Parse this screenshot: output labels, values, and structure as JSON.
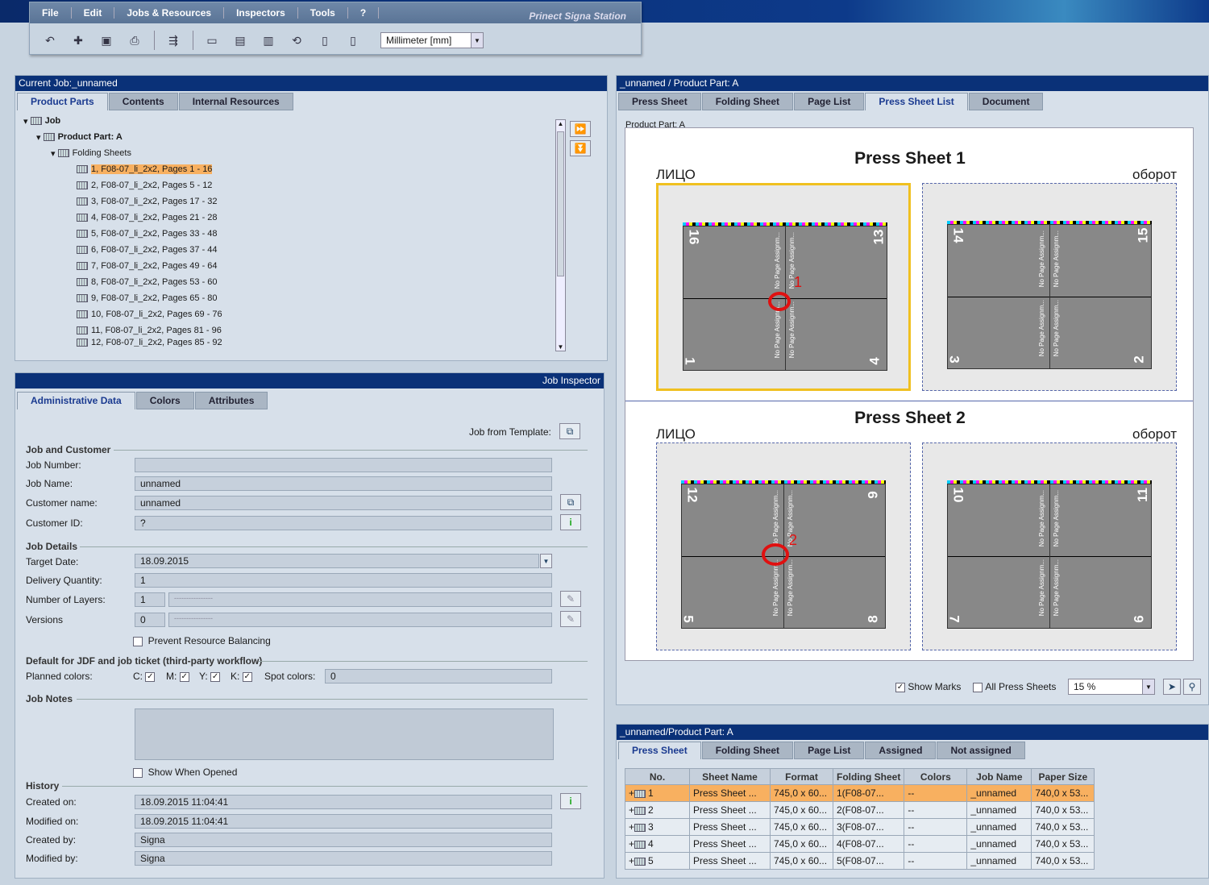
{
  "app": {
    "title": "Prinect Signa Station"
  },
  "menu": [
    "File",
    "Edit",
    "Jobs & Resources",
    "Inspectors",
    "Tools",
    "?"
  ],
  "toolbar": {
    "units": "Millimeter  [mm]"
  },
  "job_panel": {
    "title": "Current Job:_unnamed",
    "tabs": [
      "Product Parts",
      "Contents",
      "Internal Resources"
    ],
    "tree": {
      "job": "Job",
      "product_part": "Product Part: A",
      "folding_sheets": "Folding Sheets",
      "items": [
        "1, F08-07_li_2x2, Pages 1 - 16",
        "2, F08-07_li_2x2, Pages 5 - 12",
        "3, F08-07_li_2x2, Pages 17 - 32",
        "4, F08-07_li_2x2, Pages 21 - 28",
        "5, F08-07_li_2x2, Pages 33 - 48",
        "6, F08-07_li_2x2, Pages 37 - 44",
        "7, F08-07_li_2x2, Pages 49 - 64",
        "8, F08-07_li_2x2, Pages 53 - 60",
        "9, F08-07_li_2x2, Pages 65 - 80",
        "10, F08-07_li_2x2, Pages 69 - 76",
        "11, F08-07_li_2x2, Pages 81 - 96",
        "12, F08-07_li_2x2, Pages 85 - 92"
      ]
    }
  },
  "inspector": {
    "title": "Job Inspector",
    "tabs": [
      "Administrative Data",
      "Colors",
      "Attributes"
    ],
    "job_from_template": "Job from Template:",
    "sec_job_customer": "Job and Customer",
    "job_number_label": "Job Number:",
    "job_number": "",
    "job_name_label": "Job Name:",
    "job_name": "unnamed",
    "customer_name_label": "Customer name:",
    "customer_name": "unnamed",
    "customer_id_label": "Customer ID:",
    "customer_id": "?",
    "sec_job_details": "Job Details",
    "target_date_label": "Target Date:",
    "target_date": "18.09.2015",
    "delivery_qty_label": "Delivery Quantity:",
    "delivery_qty": "1",
    "layers_label": "Number of Layers:",
    "layers": "1",
    "versions_label": "Versions",
    "versions": "0",
    "dashes": "----------------",
    "prevent_balancing": "Prevent Resource Balancing",
    "sec_jdf": "Default for JDF and job ticket (third-party workflow)",
    "planned_colors_label": "Planned colors:",
    "c": "C:",
    "m": "M:",
    "y": "Y:",
    "k": "K:",
    "spot_label": "Spot colors:",
    "spot": "0",
    "sec_notes": "Job Notes",
    "show_when_opened": "Show When Opened",
    "sec_history": "History",
    "created_on_label": "Created on:",
    "created_on": "18.09.2015   11:04:41",
    "modified_on_label": "Modified on:",
    "modified_on": "18.09.2015   11:04:41",
    "created_by_label": "Created by:",
    "created_by": "Signa",
    "modified_by_label": "Modified by:",
    "modified_by": "Signa"
  },
  "preview": {
    "title": "_unnamed / Product Part: A",
    "tabs": [
      "Press Sheet",
      "Folding Sheet",
      "Page List",
      "Press Sheet List",
      "Document"
    ],
    "product_part": "Product Part: A",
    "sheets": [
      {
        "title": "Press Sheet 1",
        "front": "ЛИЦО",
        "back": "оборот",
        "front_pages": [
          "16",
          "13",
          "1",
          "4"
        ],
        "back_pages": [
          "14",
          "15",
          "3",
          "2"
        ],
        "mark": "1"
      },
      {
        "title": "Press Sheet 2",
        "front": "ЛИЦО",
        "back": "оборот",
        "front_pages": [
          "12",
          "9",
          "5",
          "8"
        ],
        "back_pages": [
          "10",
          "11",
          "7",
          "6"
        ],
        "mark": "2"
      }
    ],
    "npa_text": "No Page Assignm...",
    "show_marks": "Show Marks",
    "all_press_sheets": "All Press Sheets",
    "zoom": "15 %"
  },
  "sheet_list": {
    "title": "_unnamed/Product Part: A",
    "tabs": [
      "Press Sheet",
      "Folding Sheet",
      "Page List",
      "Assigned",
      "Not assigned"
    ],
    "columns": [
      "No.",
      "Sheet Name",
      "Format",
      "Folding Sheet",
      "Colors",
      "Job Name",
      "Paper Size"
    ],
    "rows": [
      [
        "1",
        "Press Sheet ...",
        "745,0 x 60...",
        "1(F08-07...",
        "--",
        "_unnamed",
        "740,0 x 53..."
      ],
      [
        "2",
        "Press Sheet ...",
        "745,0 x 60...",
        "2(F08-07...",
        "--",
        "_unnamed",
        "740,0 x 53..."
      ],
      [
        "3",
        "Press Sheet ...",
        "745,0 x 60...",
        "3(F08-07...",
        "--",
        "_unnamed",
        "740,0 x 53..."
      ],
      [
        "4",
        "Press Sheet ...",
        "745,0 x 60...",
        "4(F08-07...",
        "--",
        "_unnamed",
        "740,0 x 53..."
      ],
      [
        "5",
        "Press Sheet ...",
        "745,0 x 60...",
        "5(F08-07...",
        "--",
        "_unnamed",
        "740,0 x 53..."
      ]
    ]
  }
}
